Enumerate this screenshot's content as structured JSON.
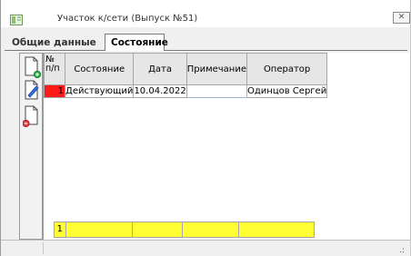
{
  "window": {
    "title": "Участок к/сети (Выпуск №51)",
    "close_glyph": "✕"
  },
  "tabs": [
    {
      "label": "Общие данные",
      "active": false
    },
    {
      "label": "Состояние",
      "active": true
    }
  ],
  "toolbar": {
    "buttons": [
      {
        "icon": "add-document-icon",
        "accent": "#2fb34a"
      },
      {
        "icon": "edit-document-icon",
        "accent": "#2f6fd6"
      },
      {
        "icon": "delete-document-icon",
        "accent": "#e0404a"
      }
    ]
  },
  "table": {
    "columns": [
      "№\nп/п",
      "Состояние",
      "Дата",
      "Примечание",
      "Оператор"
    ],
    "rows": [
      {
        "num": "1",
        "state": "Действующий",
        "date": "10.04.2022",
        "note": "",
        "operator": "Одинцов Сергей"
      }
    ],
    "footer": {
      "count": "1"
    }
  },
  "colors": {
    "row_marker": "#ff1a1a",
    "footer_bg": "#ffff33"
  },
  "statusbar": {
    "grip": ".:"
  }
}
